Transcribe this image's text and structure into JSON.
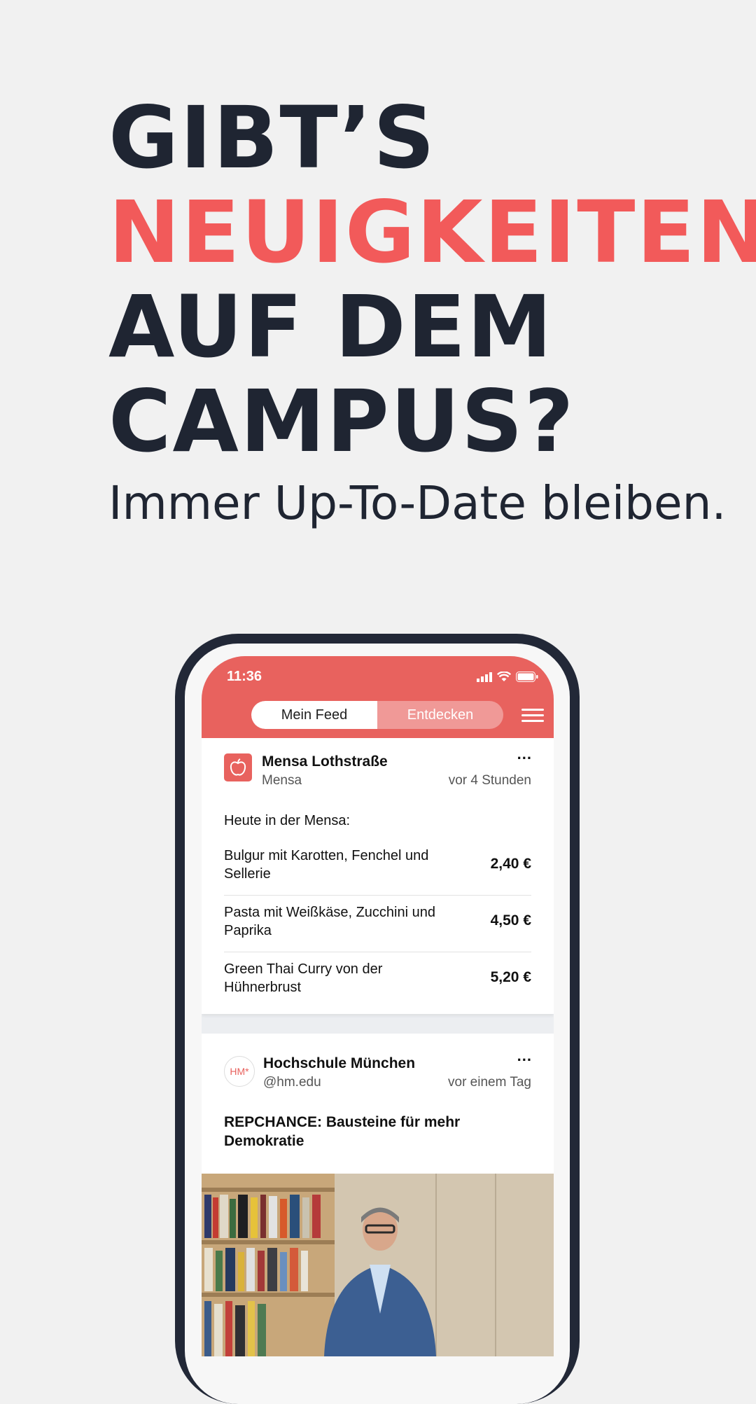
{
  "headline": {
    "line1": "GIBT’S",
    "line2": "NEUIGKEITEN",
    "line3": "AUF DEM",
    "line4": "CAMPUS?",
    "subline": "Immer Up-To-Date bleiben."
  },
  "colors": {
    "accent": "#f25a5a",
    "dark": "#1f2532",
    "appbar": "#e8625e"
  },
  "status": {
    "time": "11:36"
  },
  "tabs": [
    {
      "label": "Mein Feed",
      "active": true
    },
    {
      "label": "Entdecken",
      "active": false
    }
  ],
  "posts": [
    {
      "author": "Mensa Lothstraße",
      "handle": "Mensa",
      "time": "vor 4 Stunden",
      "more": "...",
      "intro": "Heute in der Mensa:",
      "menu": [
        {
          "dish": "Bulgur mit Karotten, Fenchel und Sellerie",
          "price": "2,40 €"
        },
        {
          "dish": "Pasta mit Weißkäse, Zucchini und Paprika",
          "price": "4,50 €"
        },
        {
          "dish": "Green Thai Curry von der Hühnerbrust",
          "price": "5,20 €"
        }
      ]
    },
    {
      "author": "Hochschule München",
      "handle": "@hm.edu",
      "time": "vor einem Tag",
      "more": "...",
      "avatar_text": "HM*",
      "title": "REPCHANCE: Bausteine für mehr Demokratie"
    }
  ]
}
